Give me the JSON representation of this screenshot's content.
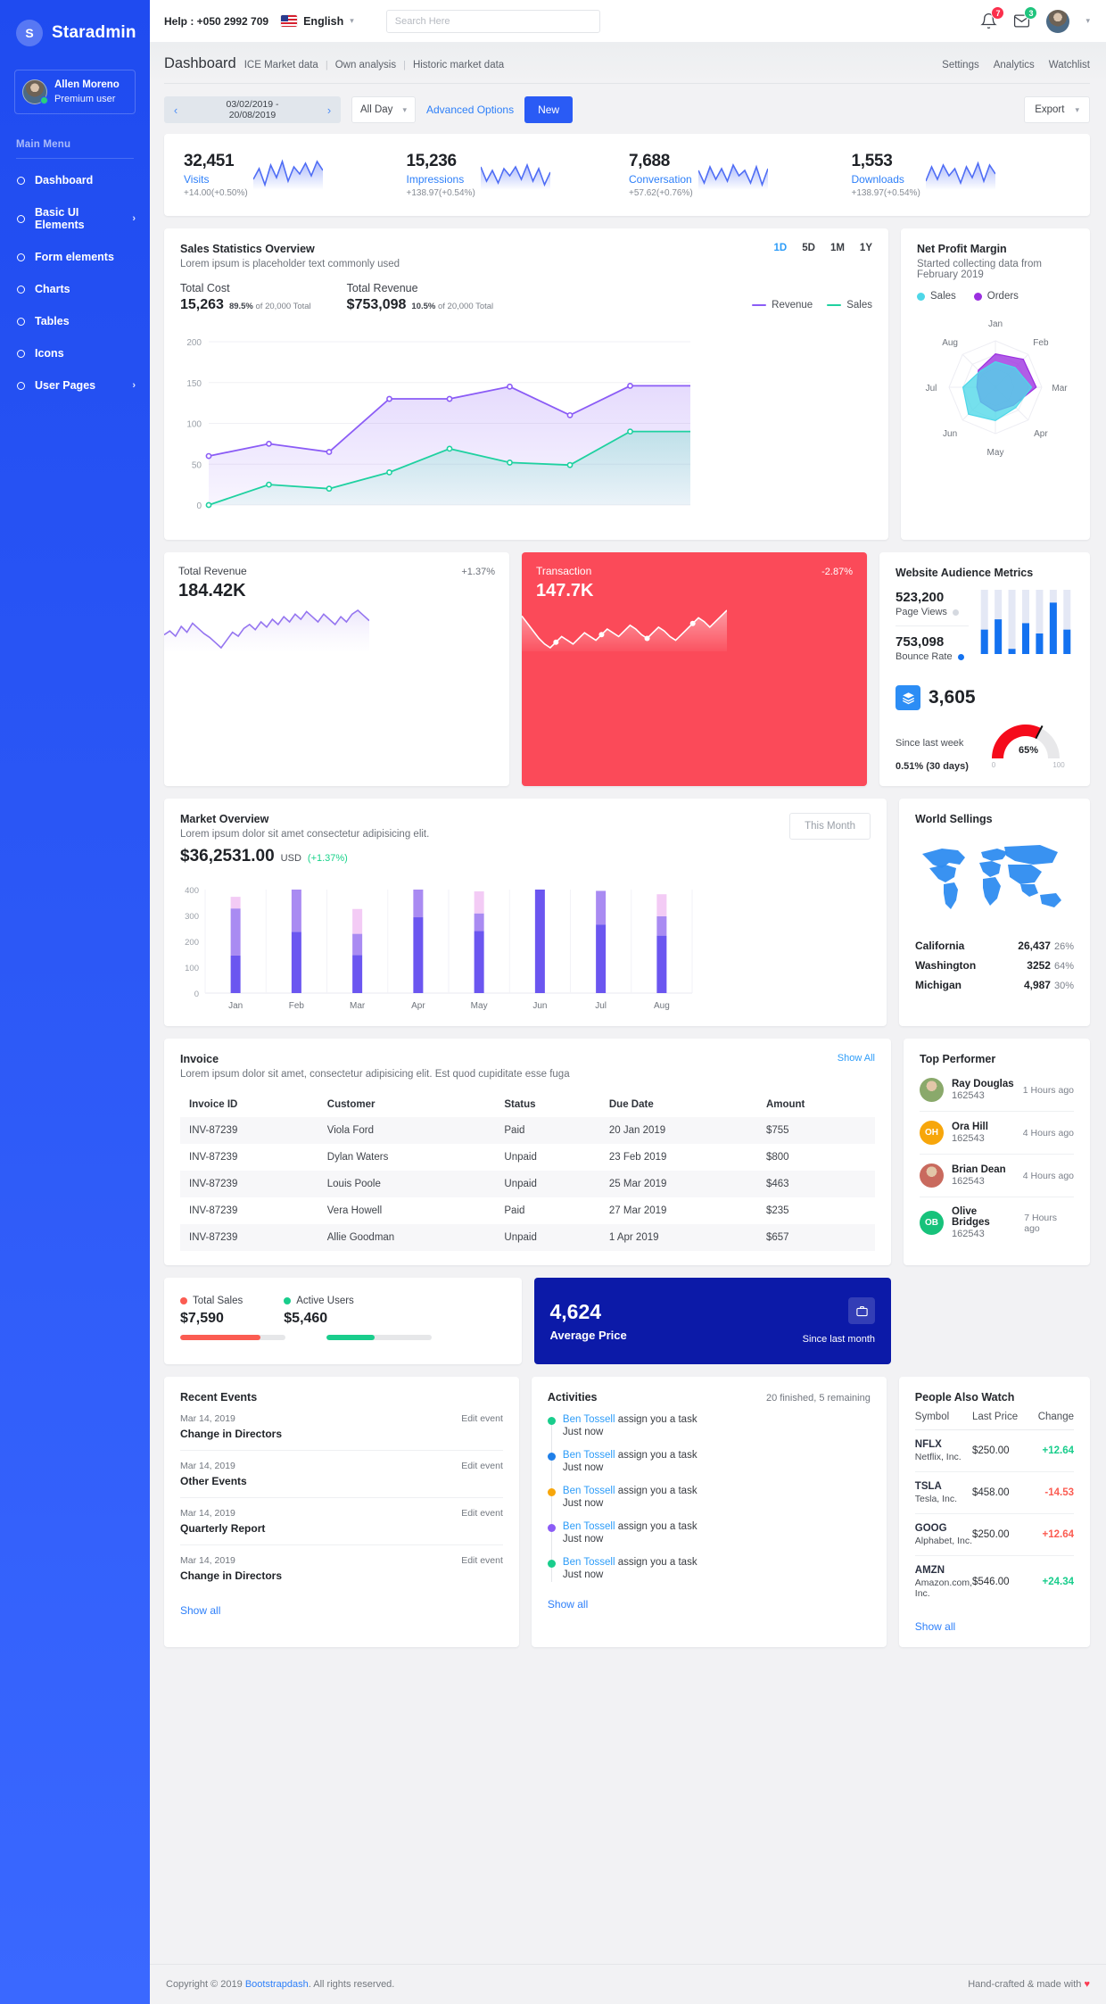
{
  "brand": {
    "logo_letter": "S",
    "name": "Staradmin"
  },
  "profile": {
    "name": "Allen Moreno",
    "role": "Premium user"
  },
  "sidebar": {
    "menu_label": "Main Menu",
    "items": [
      {
        "label": "Dashboard",
        "arrow": ""
      },
      {
        "label": "Basic UI Elements",
        "arrow": "›"
      },
      {
        "label": "Form elements",
        "arrow": ""
      },
      {
        "label": "Charts",
        "arrow": ""
      },
      {
        "label": "Tables",
        "arrow": ""
      },
      {
        "label": "Icons",
        "arrow": ""
      },
      {
        "label": "User Pages",
        "arrow": "›"
      }
    ]
  },
  "topbar": {
    "help": "Help : +050 2992 709",
    "language": "English",
    "search_placeholder": "Search Here",
    "search_value": "",
    "bell_badge": "7",
    "mail_badge": "3"
  },
  "pagehead": {
    "title": "Dashboard",
    "crumbs": [
      "ICE Market data",
      "Own analysis",
      "Historic market data"
    ],
    "links": [
      "Settings",
      "Analytics",
      "Watchlist"
    ]
  },
  "toolbar": {
    "date_from": "03/02/2019 -",
    "date_to": "20/08/2019",
    "period": "All Day",
    "advanced": "Advanced Options",
    "new": "New",
    "export": "Export"
  },
  "stats": [
    {
      "value": "32,451",
      "label": "Visits",
      "delta": "+14.00(+0.50%)"
    },
    {
      "value": "15,236",
      "label": "Impressions",
      "delta": "+138.97(+0.54%)"
    },
    {
      "value": "7,688",
      "label": "Conversation",
      "delta": "+57.62(+0.76%)"
    },
    {
      "value": "1,553",
      "label": "Downloads",
      "delta": "+138.97(+0.54%)"
    }
  ],
  "sales": {
    "title": "Sales Statistics Overview",
    "subtitle": "Lorem ipsum is placeholder text commonly used",
    "ranges": [
      "1D",
      "5D",
      "1M",
      "1Y"
    ],
    "active_range": "1D",
    "cost_label": "Total Cost",
    "cost_value": "15,263",
    "cost_of_pct": "89.5%",
    "cost_of_text": "of 20,000 Total",
    "rev_label": "Total Revenue",
    "rev_value": "$753,098",
    "rev_of_pct": "10.5%",
    "rev_of_text": "of 20,000 Total",
    "legend": [
      {
        "name": "Revenue",
        "color": "#8b5cf6"
      },
      {
        "name": "Sales",
        "color": "#1fd1a0"
      }
    ]
  },
  "netprofit": {
    "title": "Net Profit Margin",
    "subtitle": "Started collecting data from February 2019",
    "legend": [
      {
        "name": "Sales",
        "color": "#4ed7e8"
      },
      {
        "name": "Orders",
        "color": "#9b2fe0"
      }
    ]
  },
  "tiles": [
    {
      "label": "Total Revenue",
      "change": "+1.37%",
      "value": "184.42K"
    },
    {
      "label": "Transaction",
      "change": "-2.87%",
      "value": "147.7K"
    }
  ],
  "market": {
    "title": "Market Overview",
    "subtitle": "Lorem ipsum dolor sit amet consectetur adipisicing elit.",
    "button": "This Month",
    "amount": "$36,2531.00",
    "currency": "USD",
    "change": "(+1.37%)"
  },
  "audience": {
    "title": "Website Audience Metrics",
    "page_views_value": "523,200",
    "page_views_label": "Page Views",
    "bounce_value": "753,098",
    "bounce_label": "Bounce Rate",
    "counter_value": "3,605",
    "counter_label": "Since last week",
    "counter_sub": "0.51% (30 days)",
    "gauge_value": "65%",
    "gauge_min": "0",
    "gauge_max": "100"
  },
  "world": {
    "title": "World Sellings",
    "rows": [
      {
        "name": "California",
        "value": "26,437",
        "pct": "26%"
      },
      {
        "name": "Washington",
        "value": "3252",
        "pct": "64%"
      },
      {
        "name": "Michigan",
        "value": "4,987",
        "pct": "30%"
      }
    ]
  },
  "performer": {
    "title": "Top Performer",
    "rows": [
      {
        "name": "Ray Douglas",
        "id": "162543",
        "time": "1 Hours ago",
        "initials": "",
        "color": "#8aa96b"
      },
      {
        "name": "Ora Hill",
        "id": "162543",
        "time": "4 Hours ago",
        "initials": "OH",
        "color": "#f7a60b"
      },
      {
        "name": "Brian Dean",
        "id": "162543",
        "time": "4 Hours ago",
        "initials": "",
        "color": "#c96a5e"
      },
      {
        "name": "Olive Bridges",
        "id": "162543",
        "time": "7 Hours ago",
        "initials": "OB",
        "color": "#17c27b"
      }
    ]
  },
  "invoice": {
    "title": "Invoice",
    "subtitle": "Lorem ipsum dolor sit amet, consectetur adipisicing elit. Est quod cupiditate esse fuga",
    "show_all": "Show All",
    "columns": [
      "Invoice ID",
      "Customer",
      "Status",
      "Due Date",
      "Amount"
    ],
    "rows": [
      [
        "INV-87239",
        "Viola Ford",
        "Paid",
        "20 Jan 2019",
        "$755"
      ],
      [
        "INV-87239",
        "Dylan Waters",
        "Unpaid",
        "23 Feb 2019",
        "$800"
      ],
      [
        "INV-87239",
        "Louis Poole",
        "Unpaid",
        "25 Mar 2019",
        "$463"
      ],
      [
        "INV-87239",
        "Vera Howell",
        "Paid",
        "27 Mar 2019",
        "$235"
      ],
      [
        "INV-87239",
        "Allie Goodman",
        "Unpaid",
        "1 Apr 2019",
        "$657"
      ]
    ]
  },
  "totals": {
    "sales_label": "Total Sales",
    "sales_value": "$7,590",
    "sales_color": "#fb5c52",
    "sales_pct": 76,
    "users_label": "Active Users",
    "users_value": "$5,460",
    "users_color": "#19cd8c",
    "users_pct": 46
  },
  "average": {
    "value": "4,624",
    "label": "Average Price",
    "since": "Since last month"
  },
  "events": {
    "title": "Recent Events",
    "show_all": "Show all",
    "rows": [
      {
        "date": "Mar 14, 2019",
        "edit": "Edit event",
        "title": "Change in Directors"
      },
      {
        "date": "Mar 14, 2019",
        "edit": "Edit event",
        "title": "Other Events"
      },
      {
        "date": "Mar 14, 2019",
        "edit": "Edit event",
        "title": "Quarterly Report"
      },
      {
        "date": "Mar 14, 2019",
        "edit": "Edit event",
        "title": "Change in Directors"
      }
    ]
  },
  "activities": {
    "title": "Activities",
    "meta": "20 finished, 5 remaining",
    "show_all": "Show all",
    "rows": [
      {
        "user": "Ben Tossell",
        "text": " assign you a task",
        "when": "Just now",
        "color": "#19cd8c"
      },
      {
        "user": "Ben Tossell",
        "text": " assign you a task",
        "when": "Just now",
        "color": "#1f7fe8"
      },
      {
        "user": "Ben Tossell",
        "text": " assign you a task",
        "when": "Just now",
        "color": "#f7a60b"
      },
      {
        "user": "Ben Tossell",
        "text": " assign you a task",
        "when": "Just now",
        "color": "#8b5cf6"
      },
      {
        "user": "Ben Tossell",
        "text": " assign you a task",
        "when": "Just now",
        "color": "#19cd8c"
      }
    ]
  },
  "watch": {
    "title": "People Also Watch",
    "columns": [
      "Symbol",
      "Last Price",
      "Change"
    ],
    "show_all": "Show all",
    "rows": [
      {
        "symbol": "NFLX",
        "company": "Netflix, Inc.",
        "price": "$250.00",
        "change": "+12.64",
        "color": "#19cd8c"
      },
      {
        "symbol": "TSLA",
        "company": "Tesla, Inc.",
        "price": "$458.00",
        "change": "-14.53",
        "color": "#fb5c52"
      },
      {
        "symbol": "GOOG",
        "company": "Alphabet, Inc.",
        "price": "$250.00",
        "change": "+12.64",
        "color": "#fb5c52"
      },
      {
        "symbol": "AMZN",
        "company": "Amazon.com, Inc.",
        "price": "$546.00",
        "change": "+24.34",
        "color": "#19cd8c"
      }
    ]
  },
  "footer": {
    "copyright_pre": "Copyright © 2019 ",
    "link": "Bootstrapdash",
    "copyright_post": ". All rights reserved.",
    "right_pre": "Hand-crafted & made with ",
    "heart": "♥"
  },
  "chart_data": [
    {
      "type": "area",
      "title": "Sales Statistics Overview",
      "x": [
        1,
        2,
        3,
        4,
        5,
        6,
        7,
        8,
        9
      ],
      "ylim": [
        0,
        200
      ],
      "yticks": [
        0,
        50,
        100,
        150,
        200
      ],
      "grid": true,
      "legend": "top-right",
      "series": [
        {
          "name": "Revenue",
          "color": "#8b5cf6",
          "values": [
            60,
            75,
            65,
            130,
            130,
            145,
            110,
            146,
            146
          ]
        },
        {
          "name": "Sales",
          "color": "#1fd1a0",
          "values": [
            0,
            25,
            20,
            40,
            69,
            52,
            49,
            90,
            90
          ]
        }
      ]
    },
    {
      "type": "radar",
      "title": "Net Profit Margin",
      "categories": [
        "Jan",
        "Feb",
        "Mar",
        "Apr",
        "May",
        "Jun",
        "Jul",
        "Aug"
      ],
      "series": [
        {
          "name": "Sales",
          "color": "#4ed7e8",
          "values": [
            55,
            60,
            78,
            62,
            72,
            82,
            70,
            48
          ]
        },
        {
          "name": "Orders",
          "color": "#9b2fe0",
          "values": [
            72,
            85,
            88,
            55,
            52,
            45,
            40,
            52
          ]
        }
      ]
    },
    {
      "type": "line",
      "title": "Total Revenue",
      "color": "#8b5cf6",
      "values": [
        42,
        48,
        40,
        55,
        46,
        60,
        52,
        44,
        38,
        30,
        22,
        34,
        46,
        40,
        52,
        58,
        50,
        62,
        54,
        66,
        58,
        70,
        62,
        74,
        66,
        78,
        70,
        62,
        74,
        66,
        58,
        70,
        62,
        74,
        80,
        72,
        64
      ]
    },
    {
      "type": "area",
      "title": "Transaction",
      "color": "#ffffff",
      "values": [
        52,
        44,
        36,
        28,
        22,
        18,
        24,
        30,
        26,
        22,
        28,
        34,
        30,
        26,
        32,
        38,
        34,
        30,
        36,
        42,
        38,
        32,
        28,
        34,
        40,
        36,
        30,
        26,
        32,
        38,
        44,
        50,
        46,
        40,
        46,
        52,
        58
      ]
    },
    {
      "type": "bar",
      "title": "Market Overview",
      "categories": [
        "Jan",
        "Feb",
        "Mar",
        "Apr",
        "May",
        "Jun",
        "Jul",
        "Aug"
      ],
      "ylim": [
        0,
        400
      ],
      "yticks": [
        0,
        100,
        200,
        300,
        400
      ],
      "series": [
        {
          "name": "Base",
          "color": "#6b56f0",
          "values": [
            145,
            237,
            147,
            293,
            240,
            400,
            265,
            222
          ]
        },
        {
          "name": "Mid",
          "color": "#a98bf2",
          "values": [
            182,
            163,
            82,
            107,
            68,
            0,
            130,
            75
          ]
        },
        {
          "name": "Top",
          "color": "#f3cbf5",
          "values": [
            45,
            0,
            96,
            0,
            85,
            0,
            0,
            85
          ]
        }
      ]
    },
    {
      "type": "bar",
      "title": "Website Audience Metrics",
      "categories": [
        "1",
        "2",
        "3",
        "4",
        "5",
        "6",
        "7"
      ],
      "series": [
        {
          "name": "Track",
          "color": "#e4e8f5",
          "values": [
            100,
            100,
            100,
            100,
            100,
            100,
            100
          ]
        },
        {
          "name": "Bounce Rate",
          "color": "#1472f0",
          "values": [
            38,
            54,
            8,
            48,
            32,
            80,
            38
          ]
        }
      ]
    },
    {
      "type": "gauge",
      "title": "Counter",
      "value": 65,
      "min": 0,
      "max": 100,
      "color": "#f50b1b"
    },
    {
      "type": "bar",
      "title": "Total Sales / Active Users",
      "categories": [
        "Total Sales",
        "Active Users"
      ],
      "values": [
        76,
        46
      ],
      "ylim": [
        0,
        100
      ]
    }
  ]
}
